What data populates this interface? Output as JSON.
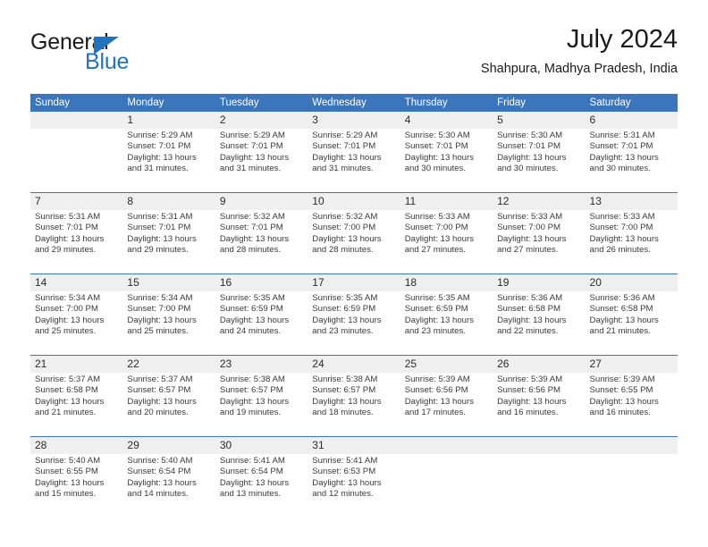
{
  "brand": {
    "name_top": "General",
    "name_bottom": "Blue",
    "triangle_icon": "blue-triangle-icon",
    "color_blue": "#1f74bd",
    "color_dark": "#1a1a1a"
  },
  "header": {
    "month_title": "July 2024",
    "location": "Shahpura, Madhya Pradesh, India"
  },
  "theme": {
    "header_blue": "#3b76bd",
    "daynum_band": "#efefef",
    "text": "#3a3a3a"
  },
  "calendar": {
    "weekday_headers": [
      "Sunday",
      "Monday",
      "Tuesday",
      "Wednesday",
      "Thursday",
      "Friday",
      "Saturday"
    ],
    "weeks": [
      [
        {
          "day": "",
          "sunrise": "",
          "sunset": "",
          "daylight_line1": "",
          "daylight_line2": ""
        },
        {
          "day": "1",
          "sunrise": "Sunrise: 5:29 AM",
          "sunset": "Sunset: 7:01 PM",
          "daylight_line1": "Daylight: 13 hours",
          "daylight_line2": "and 31 minutes."
        },
        {
          "day": "2",
          "sunrise": "Sunrise: 5:29 AM",
          "sunset": "Sunset: 7:01 PM",
          "daylight_line1": "Daylight: 13 hours",
          "daylight_line2": "and 31 minutes."
        },
        {
          "day": "3",
          "sunrise": "Sunrise: 5:29 AM",
          "sunset": "Sunset: 7:01 PM",
          "daylight_line1": "Daylight: 13 hours",
          "daylight_line2": "and 31 minutes."
        },
        {
          "day": "4",
          "sunrise": "Sunrise: 5:30 AM",
          "sunset": "Sunset: 7:01 PM",
          "daylight_line1": "Daylight: 13 hours",
          "daylight_line2": "and 30 minutes."
        },
        {
          "day": "5",
          "sunrise": "Sunrise: 5:30 AM",
          "sunset": "Sunset: 7:01 PM",
          "daylight_line1": "Daylight: 13 hours",
          "daylight_line2": "and 30 minutes."
        },
        {
          "day": "6",
          "sunrise": "Sunrise: 5:31 AM",
          "sunset": "Sunset: 7:01 PM",
          "daylight_line1": "Daylight: 13 hours",
          "daylight_line2": "and 30 minutes."
        }
      ],
      [
        {
          "day": "7",
          "sunrise": "Sunrise: 5:31 AM",
          "sunset": "Sunset: 7:01 PM",
          "daylight_line1": "Daylight: 13 hours",
          "daylight_line2": "and 29 minutes."
        },
        {
          "day": "8",
          "sunrise": "Sunrise: 5:31 AM",
          "sunset": "Sunset: 7:01 PM",
          "daylight_line1": "Daylight: 13 hours",
          "daylight_line2": "and 29 minutes."
        },
        {
          "day": "9",
          "sunrise": "Sunrise: 5:32 AM",
          "sunset": "Sunset: 7:01 PM",
          "daylight_line1": "Daylight: 13 hours",
          "daylight_line2": "and 28 minutes."
        },
        {
          "day": "10",
          "sunrise": "Sunrise: 5:32 AM",
          "sunset": "Sunset: 7:00 PM",
          "daylight_line1": "Daylight: 13 hours",
          "daylight_line2": "and 28 minutes."
        },
        {
          "day": "11",
          "sunrise": "Sunrise: 5:33 AM",
          "sunset": "Sunset: 7:00 PM",
          "daylight_line1": "Daylight: 13 hours",
          "daylight_line2": "and 27 minutes."
        },
        {
          "day": "12",
          "sunrise": "Sunrise: 5:33 AM",
          "sunset": "Sunset: 7:00 PM",
          "daylight_line1": "Daylight: 13 hours",
          "daylight_line2": "and 27 minutes."
        },
        {
          "day": "13",
          "sunrise": "Sunrise: 5:33 AM",
          "sunset": "Sunset: 7:00 PM",
          "daylight_line1": "Daylight: 13 hours",
          "daylight_line2": "and 26 minutes."
        }
      ],
      [
        {
          "day": "14",
          "sunrise": "Sunrise: 5:34 AM",
          "sunset": "Sunset: 7:00 PM",
          "daylight_line1": "Daylight: 13 hours",
          "daylight_line2": "and 25 minutes."
        },
        {
          "day": "15",
          "sunrise": "Sunrise: 5:34 AM",
          "sunset": "Sunset: 7:00 PM",
          "daylight_line1": "Daylight: 13 hours",
          "daylight_line2": "and 25 minutes."
        },
        {
          "day": "16",
          "sunrise": "Sunrise: 5:35 AM",
          "sunset": "Sunset: 6:59 PM",
          "daylight_line1": "Daylight: 13 hours",
          "daylight_line2": "and 24 minutes."
        },
        {
          "day": "17",
          "sunrise": "Sunrise: 5:35 AM",
          "sunset": "Sunset: 6:59 PM",
          "daylight_line1": "Daylight: 13 hours",
          "daylight_line2": "and 23 minutes."
        },
        {
          "day": "18",
          "sunrise": "Sunrise: 5:35 AM",
          "sunset": "Sunset: 6:59 PM",
          "daylight_line1": "Daylight: 13 hours",
          "daylight_line2": "and 23 minutes."
        },
        {
          "day": "19",
          "sunrise": "Sunrise: 5:36 AM",
          "sunset": "Sunset: 6:58 PM",
          "daylight_line1": "Daylight: 13 hours",
          "daylight_line2": "and 22 minutes."
        },
        {
          "day": "20",
          "sunrise": "Sunrise: 5:36 AM",
          "sunset": "Sunset: 6:58 PM",
          "daylight_line1": "Daylight: 13 hours",
          "daylight_line2": "and 21 minutes."
        }
      ],
      [
        {
          "day": "21",
          "sunrise": "Sunrise: 5:37 AM",
          "sunset": "Sunset: 6:58 PM",
          "daylight_line1": "Daylight: 13 hours",
          "daylight_line2": "and 21 minutes."
        },
        {
          "day": "22",
          "sunrise": "Sunrise: 5:37 AM",
          "sunset": "Sunset: 6:57 PM",
          "daylight_line1": "Daylight: 13 hours",
          "daylight_line2": "and 20 minutes."
        },
        {
          "day": "23",
          "sunrise": "Sunrise: 5:38 AM",
          "sunset": "Sunset: 6:57 PM",
          "daylight_line1": "Daylight: 13 hours",
          "daylight_line2": "and 19 minutes."
        },
        {
          "day": "24",
          "sunrise": "Sunrise: 5:38 AM",
          "sunset": "Sunset: 6:57 PM",
          "daylight_line1": "Daylight: 13 hours",
          "daylight_line2": "and 18 minutes."
        },
        {
          "day": "25",
          "sunrise": "Sunrise: 5:39 AM",
          "sunset": "Sunset: 6:56 PM",
          "daylight_line1": "Daylight: 13 hours",
          "daylight_line2": "and 17 minutes."
        },
        {
          "day": "26",
          "sunrise": "Sunrise: 5:39 AM",
          "sunset": "Sunset: 6:56 PM",
          "daylight_line1": "Daylight: 13 hours",
          "daylight_line2": "and 16 minutes."
        },
        {
          "day": "27",
          "sunrise": "Sunrise: 5:39 AM",
          "sunset": "Sunset: 6:55 PM",
          "daylight_line1": "Daylight: 13 hours",
          "daylight_line2": "and 16 minutes."
        }
      ],
      [
        {
          "day": "28",
          "sunrise": "Sunrise: 5:40 AM",
          "sunset": "Sunset: 6:55 PM",
          "daylight_line1": "Daylight: 13 hours",
          "daylight_line2": "and 15 minutes."
        },
        {
          "day": "29",
          "sunrise": "Sunrise: 5:40 AM",
          "sunset": "Sunset: 6:54 PM",
          "daylight_line1": "Daylight: 13 hours",
          "daylight_line2": "and 14 minutes."
        },
        {
          "day": "30",
          "sunrise": "Sunrise: 5:41 AM",
          "sunset": "Sunset: 6:54 PM",
          "daylight_line1": "Daylight: 13 hours",
          "daylight_line2": "and 13 minutes."
        },
        {
          "day": "31",
          "sunrise": "Sunrise: 5:41 AM",
          "sunset": "Sunset: 6:53 PM",
          "daylight_line1": "Daylight: 13 hours",
          "daylight_line2": "and 12 minutes."
        },
        {
          "day": "",
          "sunrise": "",
          "sunset": "",
          "daylight_line1": "",
          "daylight_line2": ""
        },
        {
          "day": "",
          "sunrise": "",
          "sunset": "",
          "daylight_line1": "",
          "daylight_line2": ""
        },
        {
          "day": "",
          "sunrise": "",
          "sunset": "",
          "daylight_line1": "",
          "daylight_line2": ""
        }
      ]
    ]
  }
}
